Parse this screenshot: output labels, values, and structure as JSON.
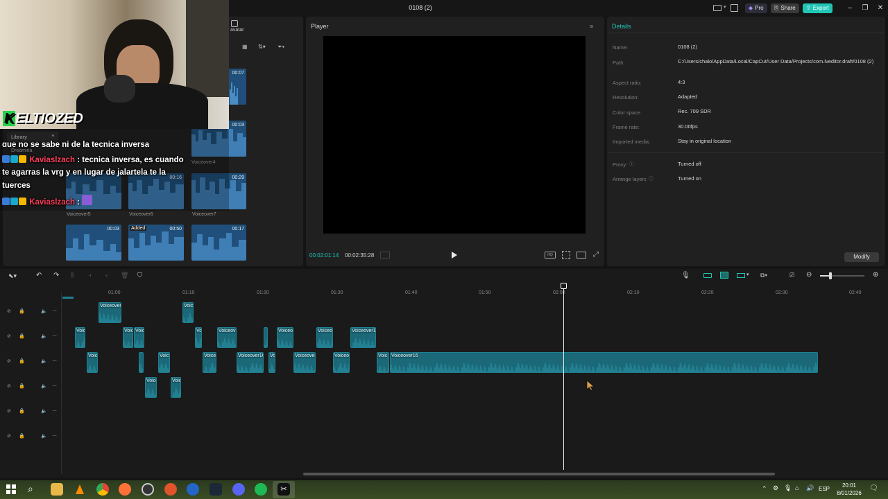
{
  "window": {
    "title": "0108 (2)",
    "pro_label": "Pro",
    "share_label": "Share",
    "export_label": "Export"
  },
  "media_panel": {
    "tab_label": "avatar",
    "library_dropdown": "Library",
    "library_subtext": "Dreamina",
    "clips": [
      {
        "duration": "00:07",
        "name": ""
      },
      {
        "duration": "00:03",
        "name": "Voiceover4"
      },
      {
        "duration": "",
        "name": "Voiceover5"
      },
      {
        "duration": "00:16",
        "name": "Voiceover6"
      },
      {
        "duration": "00:29",
        "name": "Voiceover7"
      },
      {
        "duration": "00:03",
        "name": ""
      },
      {
        "duration": "00:50",
        "name": "",
        "badge": "Added"
      },
      {
        "duration": "00:17",
        "name": ""
      }
    ]
  },
  "player": {
    "title": "Player",
    "current_time": "00:02:01:14",
    "total_time": "00:02:35:28"
  },
  "details": {
    "title": "Details",
    "rows": [
      {
        "label": "Name:",
        "value": "0108 (2)"
      },
      {
        "label": "Path:",
        "value": "C:/Users/chalo/AppData/Local/CapCut/User Data/Projects/com.lveditor.draft/0108 (2)"
      },
      {
        "label": "Aspect ratio:",
        "value": "4:3"
      },
      {
        "label": "Resolution:",
        "value": "Adapted"
      },
      {
        "label": "Color space",
        "value": "Rec. 709 SDR"
      },
      {
        "label": "Frame rate:",
        "value": "30.00fps"
      },
      {
        "label": "Imported media:",
        "value": "Stay in original location"
      },
      {
        "label": "Proxy:",
        "value": "Turned off"
      },
      {
        "label": "Arrange layers",
        "value": "Turned on"
      }
    ],
    "modify_label": "Modify"
  },
  "timeline": {
    "ruler": [
      "01:00",
      "01:10",
      "01:20",
      "01:30",
      "01:40",
      "01:50",
      "02:00",
      "02:10",
      "02:20",
      "02:30",
      "02:40"
    ],
    "playhead_time": "02:01:14",
    "tracks": [
      {
        "clips": [
          {
            "label": "Voiceover1"
          },
          {
            "label": "Voic"
          }
        ]
      },
      {
        "clips": [
          {
            "label": "Voic"
          },
          {
            "label": "Voic"
          },
          {
            "label": "Voic"
          },
          {
            "label": "Voi"
          },
          {
            "label": "Voiceov"
          },
          {
            "label": ""
          },
          {
            "label": "Voiceo"
          },
          {
            "label": "Voiceo"
          },
          {
            "label": "Voiceover1"
          }
        ]
      },
      {
        "clips": [
          {
            "label": "Voic"
          },
          {
            "label": ""
          },
          {
            "label": "Voic"
          },
          {
            "label": "Voice"
          },
          {
            "label": "Voiceover16"
          },
          {
            "label": "Voi"
          },
          {
            "label": "Voiceover"
          },
          {
            "label": "Voiceo"
          },
          {
            "label": "Voic"
          },
          {
            "label": "Voiceover16"
          }
        ]
      },
      {
        "clips": [
          {
            "label": "Voice"
          },
          {
            "label": "Voic"
          }
        ]
      },
      {
        "clips": []
      },
      {
        "clips": []
      }
    ]
  },
  "stream_overlay": {
    "streamer": "ELTIOZED",
    "chat": [
      {
        "user": "",
        "text": "que no se sabe ni de la tecnica inversa"
      },
      {
        "user": "Kaviaslzach",
        "text": ": tecnica inversa, es cuando"
      },
      {
        "user": "",
        "text": "te agarras la vrg y en lugar de jalartela te la"
      },
      {
        "user": "",
        "text": "tuerces"
      },
      {
        "user": "Kaviaslzach",
        "text": ":"
      }
    ]
  },
  "taskbar": {
    "lang": "ESP",
    "time": "20:01",
    "date": "8/01/2026"
  },
  "colors": {
    "accent": "#20c5b6",
    "clip": "#1b6878",
    "media_thumb": "#1f4f7a",
    "chat_user": "#ff3d5a"
  }
}
